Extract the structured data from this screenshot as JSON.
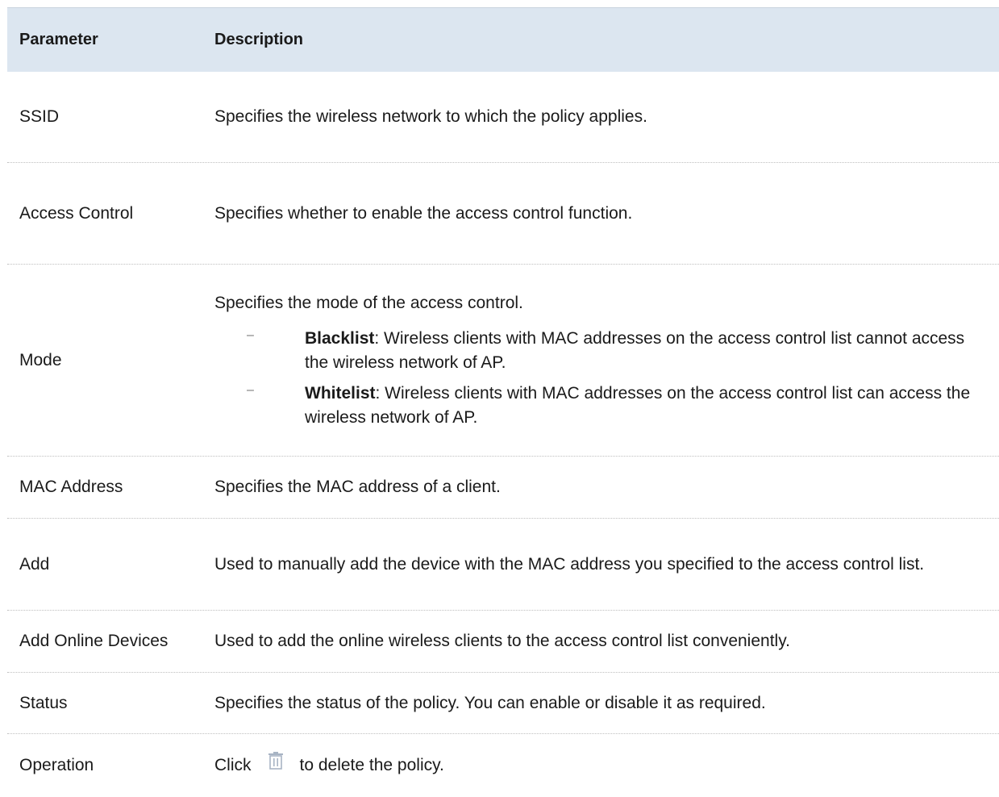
{
  "header": {
    "col_parameter": "Parameter",
    "col_description": "Description"
  },
  "rows": [
    {
      "parameter": "SSID",
      "description": "Specifies the wireless network to which the policy applies."
    },
    {
      "parameter": "Access Control",
      "description": "Specifies whether to enable the access control function."
    },
    {
      "parameter": "Mode",
      "description": "Specifies the mode of the access control.",
      "bullets": [
        {
          "term": "Blacklist",
          "text": ": Wireless clients with MAC addresses on the access control list cannot access the wireless network of AP."
        },
        {
          "term": "Whitelist",
          "text": ": Wireless clients with MAC addresses on the access control list can access the wireless network of AP."
        }
      ]
    },
    {
      "parameter": "MAC Address",
      "description": "Specifies the MAC address of a client."
    },
    {
      "parameter": "Add",
      "description": "Used to manually add the device with the MAC address you specified to the access control list."
    },
    {
      "parameter": "Add Online Devices",
      "description": "Used to add the online wireless clients to the access control list conveniently."
    },
    {
      "parameter": "Status",
      "description": "Specifies the status of the policy. You can enable or disable it as required."
    },
    {
      "parameter": "Operation",
      "description_before": "Click",
      "icon": "trash-icon",
      "description_after": "to delete the policy."
    }
  ],
  "bullet_marker": "–",
  "colors": {
    "header_bg": "#dce6f0",
    "row_divider": "#bfbfbf",
    "icon": "#a8b4c4"
  }
}
